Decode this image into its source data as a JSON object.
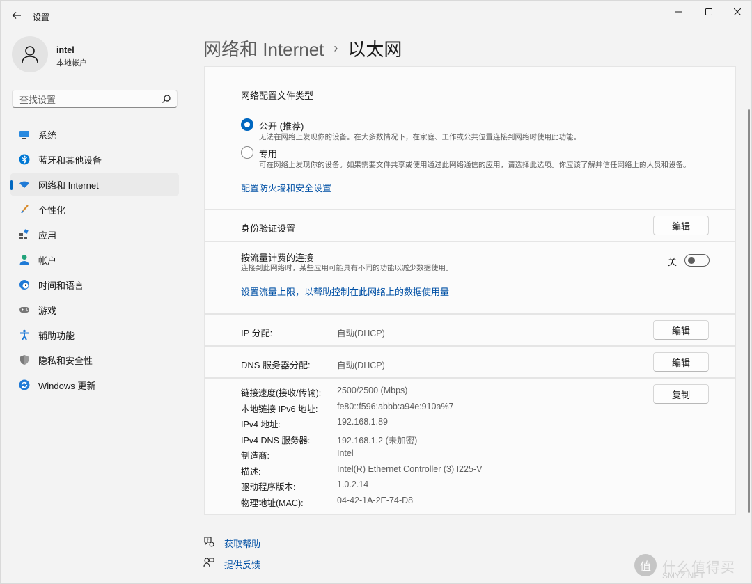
{
  "window": {
    "title": "设置"
  },
  "user": {
    "name": "intel",
    "account_type": "本地帐户"
  },
  "search": {
    "placeholder": "查找设置"
  },
  "nav": {
    "items": [
      {
        "label": "系统",
        "icon": "monitor-icon"
      },
      {
        "label": "蓝牙和其他设备",
        "icon": "bluetooth-icon"
      },
      {
        "label": "网络和 Internet",
        "icon": "wifi-icon",
        "active": true
      },
      {
        "label": "个性化",
        "icon": "brush-icon"
      },
      {
        "label": "应用",
        "icon": "apps-icon"
      },
      {
        "label": "帐户",
        "icon": "person-icon"
      },
      {
        "label": "时间和语言",
        "icon": "clock-globe-icon"
      },
      {
        "label": "游戏",
        "icon": "gamepad-icon"
      },
      {
        "label": "辅助功能",
        "icon": "accessibility-icon"
      },
      {
        "label": "隐私和安全性",
        "icon": "shield-icon"
      },
      {
        "label": "Windows 更新",
        "icon": "update-icon"
      }
    ]
  },
  "header": {
    "parent": "网络和 Internet",
    "separator": "›",
    "current": "以太网"
  },
  "profile": {
    "title": "网络配置文件类型",
    "options": [
      {
        "label": "公开 (推荐)",
        "desc": "无法在网络上发现你的设备。在大多数情况下，在家庭、工作或公共位置连接到网络时使用此功能。",
        "checked": true
      },
      {
        "label": "专用",
        "desc": "可在网络上发现你的设备。如果需要文件共享或使用通过此网络通信的应用，请选择此选项。你应该了解并信任网络上的人员和设备。",
        "checked": false
      }
    ],
    "firewall_link": "配置防火墙和安全设置"
  },
  "auth": {
    "label": "身份验证设置",
    "button": "编辑"
  },
  "metered": {
    "label": "按流量计费的连接",
    "desc": "连接到此网络时，某些应用可能具有不同的功能以减少数据使用。",
    "state": "关",
    "on": false,
    "link": "设置流量上限，以帮助控制在此网络上的数据使用量"
  },
  "ip": {
    "label": "IP 分配:",
    "value": "自动(DHCP)",
    "button": "编辑"
  },
  "dns": {
    "label": "DNS 服务器分配:",
    "value": "自动(DHCP)",
    "button": "编辑"
  },
  "properties": {
    "copy_button": "复制",
    "rows": [
      {
        "label": "链接速度(接收/传输):",
        "value": "2500/2500 (Mbps)"
      },
      {
        "label": "本地链接 IPv6 地址:",
        "value": "fe80::f596:abbb:a94e:910a%7"
      },
      {
        "label": "IPv4 地址:",
        "value": "192.168.1.89"
      },
      {
        "label": "IPv4 DNS 服务器:",
        "value": "192.168.1.2 (未加密)"
      },
      {
        "label": "制造商:",
        "value": "Intel"
      },
      {
        "label": "描述:",
        "value": "Intel(R) Ethernet Controller (3) I225-V"
      },
      {
        "label": "驱动程序版本:",
        "value": "1.0.2.14"
      },
      {
        "label": "物理地址(MAC):",
        "value": "04-42-1A-2E-74-D8"
      }
    ]
  },
  "footer": {
    "help": "获取帮助",
    "feedback": "提供反馈"
  },
  "watermark": {
    "badge": "值",
    "text": "什么值得买",
    "sub": "SMYZ.NET"
  },
  "colors": {
    "accent": "#0067c0",
    "link": "#0050a5"
  }
}
